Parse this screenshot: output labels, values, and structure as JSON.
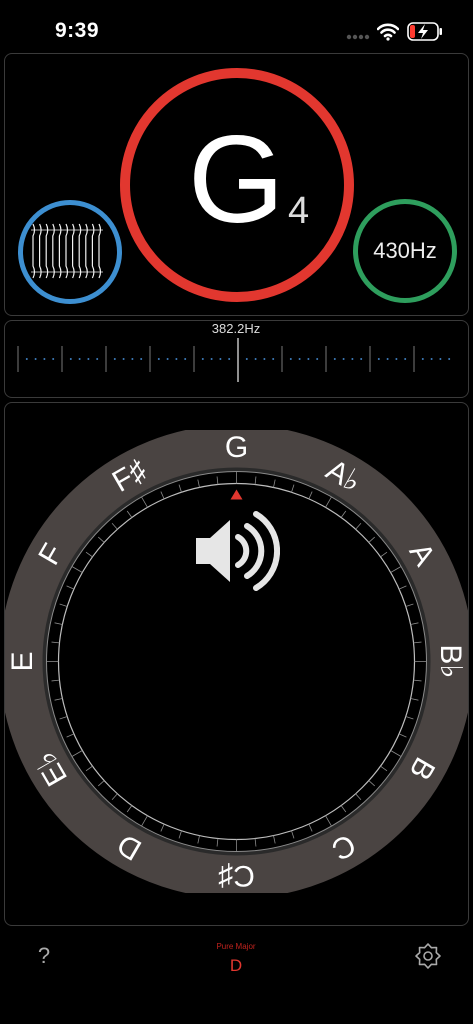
{
  "status_bar": {
    "time": "9:39",
    "icons": [
      "signal-icon",
      "wifi-icon",
      "battery-charging-icon"
    ],
    "battery_color": "#ff3b30"
  },
  "note_display": {
    "note": "G",
    "octave": "4",
    "ring_color": "#e2372f"
  },
  "waveform": {
    "ring_color": "#3d8fd1"
  },
  "reference": {
    "label": "430Hz",
    "ring_color": "#2e9e5d"
  },
  "meter": {
    "frequency": "382.2Hz"
  },
  "dial": {
    "notes": [
      "G",
      "A♭",
      "A",
      "B♭",
      "B",
      "C",
      "C♯",
      "D",
      "E♭",
      "E",
      "F",
      "F♯"
    ],
    "current_note": "G",
    "indicator_color": "#e2372f",
    "ring_color": "#4a4442"
  },
  "bottom_bar": {
    "help": "?",
    "scale": "Pure Major",
    "key": "D",
    "scale_color": "#c0231e"
  }
}
